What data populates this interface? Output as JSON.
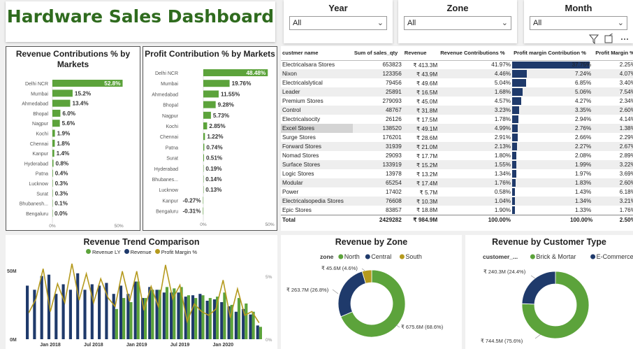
{
  "title": "Hardware Sales Dashboard",
  "slicers": [
    {
      "label": "Year",
      "value": "All"
    },
    {
      "label": "Zone",
      "value": "All"
    },
    {
      "label": "Month",
      "value": "All"
    }
  ],
  "colors": {
    "green": "#5ca33b",
    "navy": "#1f3a6b",
    "gold": "#b59a1e",
    "title": "#2f6b1e"
  },
  "revenue_contrib": {
    "title": "Revenue Contributions % by Markets",
    "axis": [
      "0%",
      "50%"
    ]
  },
  "profit_contrib": {
    "title": "Profit Contribution % by Markets",
    "axis": [
      "0%",
      "50%"
    ]
  },
  "table": {
    "headers": [
      "custmer name",
      "Sum of sales_qty",
      "Revenue",
      "Revenue Contributions %",
      "Profit margin Contribution %",
      "Profit Margin %"
    ],
    "rows": [
      [
        "Electricalsara Stores",
        "653823",
        "₹ 413.3M",
        "41.97%",
        "37.75%",
        "2.25%"
      ],
      [
        "Nixon",
        "123356",
        "₹ 43.9M",
        "4.46%",
        "7.24%",
        "4.07%"
      ],
      [
        "Electricalslytical",
        "79456",
        "₹ 49.6M",
        "5.04%",
        "6.85%",
        "3.40%"
      ],
      [
        "Leader",
        "25891",
        "₹ 16.5M",
        "1.68%",
        "5.06%",
        "7.54%"
      ],
      [
        "Premium Stores",
        "279093",
        "₹ 45.0M",
        "4.57%",
        "4.27%",
        "2.34%"
      ],
      [
        "Control",
        "48767",
        "₹ 31.8M",
        "3.23%",
        "3.35%",
        "2.60%"
      ],
      [
        "Electricalsocity",
        "26126",
        "₹ 17.5M",
        "1.78%",
        "2.94%",
        "4.14%"
      ],
      [
        "Excel Stores",
        "138520",
        "₹ 49.1M",
        "4.99%",
        "2.76%",
        "1.38%"
      ],
      [
        "Surge Stores",
        "176201",
        "₹ 28.6M",
        "2.91%",
        "2.66%",
        "2.29%"
      ],
      [
        "Forward Stores",
        "31939",
        "₹ 21.0M",
        "2.13%",
        "2.27%",
        "2.67%"
      ],
      [
        "Nomad Stores",
        "29093",
        "₹ 17.7M",
        "1.80%",
        "2.08%",
        "2.89%"
      ],
      [
        "Surface Stores",
        "133919",
        "₹ 15.2M",
        "1.55%",
        "1.99%",
        "3.22%"
      ],
      [
        "Logic Stores",
        "13978",
        "₹ 13.2M",
        "1.34%",
        "1.97%",
        "3.69%"
      ],
      [
        "Modular",
        "65254",
        "₹ 17.4M",
        "1.76%",
        "1.83%",
        "2.60%"
      ],
      [
        "Power",
        "17402",
        "₹ 5.7M",
        "0.58%",
        "1.43%",
        "6.18%"
      ],
      [
        "Electricalsopedia Stores",
        "76608",
        "₹ 10.3M",
        "1.04%",
        "1.34%",
        "3.21%"
      ],
      [
        "Epic Stores",
        "83857",
        "₹ 18.8M",
        "1.90%",
        "1.33%",
        "1.76%"
      ]
    ],
    "total": [
      "Total",
      "2429282",
      "₹ 984.9M",
      "100.00%",
      "100.00%",
      "2.50%"
    ],
    "pm_values": [
      37.75,
      7.24,
      6.85,
      5.06,
      4.27,
      3.35,
      2.94,
      2.76,
      2.66,
      2.27,
      2.08,
      1.99,
      1.97,
      1.83,
      1.43,
      1.34,
      1.33
    ]
  },
  "trend": {
    "title": "Revenue Trend Comparison",
    "legend": [
      "Revenue LY",
      "Revenue",
      "Profit Margin %"
    ],
    "y_left": [
      "50M",
      "0M"
    ],
    "y_right": [
      "5%",
      "0%"
    ],
    "x_ticks": [
      "Jan 2018",
      "Jul 2018",
      "Jan 2019",
      "Jul 2019",
      "Jan 2020"
    ]
  },
  "zone_donut": {
    "title": "Revenue by Zone",
    "legend_title": "zone",
    "labels": [
      "₹ 45.6M (4.6%)",
      "₹ 263.7M (26.8%)",
      "₹ 675.6M (68.6%)"
    ]
  },
  "customer_donut": {
    "title": "Revenue by Customer Type",
    "legend_title": "customer_...",
    "labels": [
      "₹ 240.3M (24.4%)",
      "₹ 744.5M (75.6%)"
    ]
  },
  "chart_data": [
    {
      "type": "bar",
      "title": "Revenue Contributions % by Markets",
      "categories": [
        "Delhi NCR",
        "Mumbai",
        "Ahmedabad",
        "Bhopal",
        "Nagpur",
        "Kochi",
        "Chennai",
        "Kanpur",
        "Hyderabad",
        "Patna",
        "Lucknow",
        "Surat",
        "Bhubanesh...",
        "Bengaluru"
      ],
      "values": [
        52.8,
        15.2,
        13.4,
        6.0,
        5.6,
        1.9,
        1.8,
        1.4,
        0.8,
        0.4,
        0.3,
        0.3,
        0.1,
        0.0
      ],
      "labels": [
        "52.8%",
        "15.2%",
        "13.4%",
        "6.0%",
        "5.6%",
        "1.9%",
        "1.8%",
        "1.4%",
        "0.8%",
        "0.4%",
        "0.3%",
        "0.3%",
        "0.1%",
        "0.0%"
      ],
      "xlim": [
        0,
        62
      ]
    },
    {
      "type": "bar",
      "title": "Profit Contribution % by Markets",
      "categories": [
        "Delhi NCR",
        "Mumbai",
        "Ahmedabad",
        "Bhopal",
        "Nagpur",
        "Kochi",
        "Chennai",
        "Patna",
        "Surat",
        "Hyderabad",
        "Bhubanes...",
        "Lucknow",
        "Kanpur",
        "Bengaluru"
      ],
      "values": [
        48.48,
        19.76,
        11.55,
        9.28,
        5.73,
        2.85,
        1.22,
        0.74,
        0.51,
        0.19,
        0.14,
        0.13,
        -0.27,
        -0.31
      ],
      "labels": [
        "48.48%",
        "19.76%",
        "11.55%",
        "9.28%",
        "5.73%",
        "2.85%",
        "1.22%",
        "0.74%",
        "0.51%",
        "0.19%",
        "0.14%",
        "0.13%",
        "-0.27%",
        "-0.31%"
      ],
      "xlim": [
        0,
        62
      ]
    },
    {
      "type": "bar",
      "title": "Revenue Trend Comparison",
      "x": [
        "2017-10",
        "2017-11",
        "2017-12",
        "2018-01",
        "2018-02",
        "2018-03",
        "2018-04",
        "2018-05",
        "2018-06",
        "2018-07",
        "2018-08",
        "2018-09",
        "2018-10",
        "2018-11",
        "2018-12",
        "2019-01",
        "2019-02",
        "2019-03",
        "2019-04",
        "2019-05",
        "2019-06",
        "2019-07",
        "2019-08",
        "2019-09",
        "2019-10",
        "2019-11",
        "2019-12",
        "2020-01",
        "2020-02",
        "2020-03",
        "2020-04",
        "2020-05",
        "2020-06"
      ],
      "series": [
        {
          "name": "Revenue LY",
          "values": [
            null,
            null,
            null,
            null,
            null,
            null,
            null,
            null,
            null,
            null,
            null,
            null,
            22,
            30,
            27,
            42,
            30,
            36,
            36,
            38,
            37,
            38,
            32,
            30,
            32,
            30,
            31,
            34,
            25,
            30,
            26,
            20,
            9
          ]
        },
        {
          "name": "Revenue",
          "values": [
            39,
            36,
            46,
            47,
            33,
            40,
            36,
            48,
            36,
            40,
            39,
            41,
            33,
            39,
            33,
            42,
            30,
            38,
            36,
            34,
            34,
            34,
            31,
            32,
            33,
            28,
            29,
            27,
            24,
            20,
            22,
            18,
            10
          ]
        },
        {
          "name": "Profit Margin %",
          "values": [
            2.1,
            3.2,
            5.6,
            2.2,
            4.4,
            2.9,
            6.0,
            3.1,
            5.2,
            2.9,
            4.8,
            3.3,
            2.6,
            5.4,
            3.0,
            5.4,
            2.3,
            4.2,
            2.6,
            5.9,
            3.2,
            4.3,
            1.4,
            2.8,
            2.2,
            1.9,
            2.4,
            4.7,
            1.7,
            4.0,
            1.9,
            2.2,
            1.3
          ]
        }
      ],
      "ylim": [
        0,
        55
      ],
      "y2lim": [
        0,
        6
      ]
    },
    {
      "type": "pie",
      "title": "Revenue by Zone",
      "categories": [
        "North",
        "Central",
        "South"
      ],
      "values": [
        675.6,
        263.7,
        45.6
      ],
      "percent": [
        68.6,
        26.8,
        4.6
      ],
      "colors": [
        "#5ca33b",
        "#1f3a6b",
        "#b59a1e"
      ]
    },
    {
      "type": "pie",
      "title": "Revenue by Customer Type",
      "categories": [
        "Brick & Mortar",
        "E-Commerce"
      ],
      "values": [
        744.5,
        240.3
      ],
      "percent": [
        75.6,
        24.4
      ],
      "colors": [
        "#5ca33b",
        "#1f3a6b"
      ]
    }
  ]
}
